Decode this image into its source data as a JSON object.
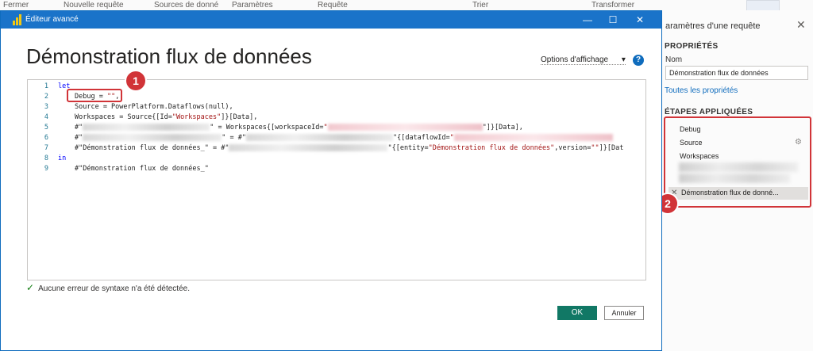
{
  "ribbon": {
    "items": [
      "Fermer",
      "Nouvelle requête",
      "Sources de donné",
      "Paramètres",
      "Requête",
      "Trier",
      "Transformer"
    ]
  },
  "dialog": {
    "window_title": "Éditeur avancé",
    "heading": "Démonstration flux de données",
    "view_options": "Options d'affichage",
    "view_options_caret": "▾",
    "help_glyph": "?",
    "minimize_glyph": "—",
    "maximize_glyph": "☐",
    "close_glyph": "✕",
    "status_icon": "✓",
    "status": "Aucune erreur de syntaxe n'a été détectée.",
    "ok": "OK",
    "cancel": "Annuler"
  },
  "code": {
    "line_numbers": [
      "1",
      "2",
      "3",
      "4",
      "5",
      "6",
      "7",
      "8",
      "9"
    ],
    "l1": "let",
    "l2a": "Debug = ",
    "l2b": "\"\"",
    "l2c": ",",
    "l3": "Source = PowerPlatform.Dataflows(null),",
    "l4a": "Workspaces = Source{[Id=",
    "l4b": "\"Workspaces\"",
    "l4c": "]}[Data],",
    "l5a": "#\"",
    "l5b": "\" = Workspaces{[workspaceId=",
    "l5c": "\"",
    "l5d": "\"]}[Data],",
    "l6a": "#\"",
    "l6b": "\" = #\"",
    "l6c": "\"{[dataflowId=",
    "l6d": "\"",
    "l7a": "#\"Démonstration flux de données_\" = #\"",
    "l7b": "\"{[entity=",
    "l7c": "\"Démonstration flux de données\"",
    "l7d": ",version=",
    "l7e": "\"\"",
    "l7f": "]}[Dat",
    "l8": "in",
    "l9": "#\"Démonstration flux de données_\""
  },
  "markers": [
    "1",
    "2"
  ],
  "query_settings": {
    "title": "aramètres d'une requête",
    "close_glyph": "✕",
    "properties_header": "PROPRIÉTÉS",
    "name_label": "Nom",
    "name_value": "Démonstration flux de données",
    "all_properties": "Toutes les propriétés",
    "steps_header": "ÉTAPES APPLIQUÉES",
    "steps": [
      "Debug",
      "Source",
      "Workspaces"
    ],
    "step_gear_glyph": "⚙",
    "step_delete_glyph": "✕",
    "selected_step": "Démonstration flux de donné..."
  },
  "colors": {
    "title_bar": "#1a73c9",
    "annotation_red": "#d13438",
    "ok_button": "#117865",
    "keyword": "#0000ff",
    "string": "#a31515"
  }
}
